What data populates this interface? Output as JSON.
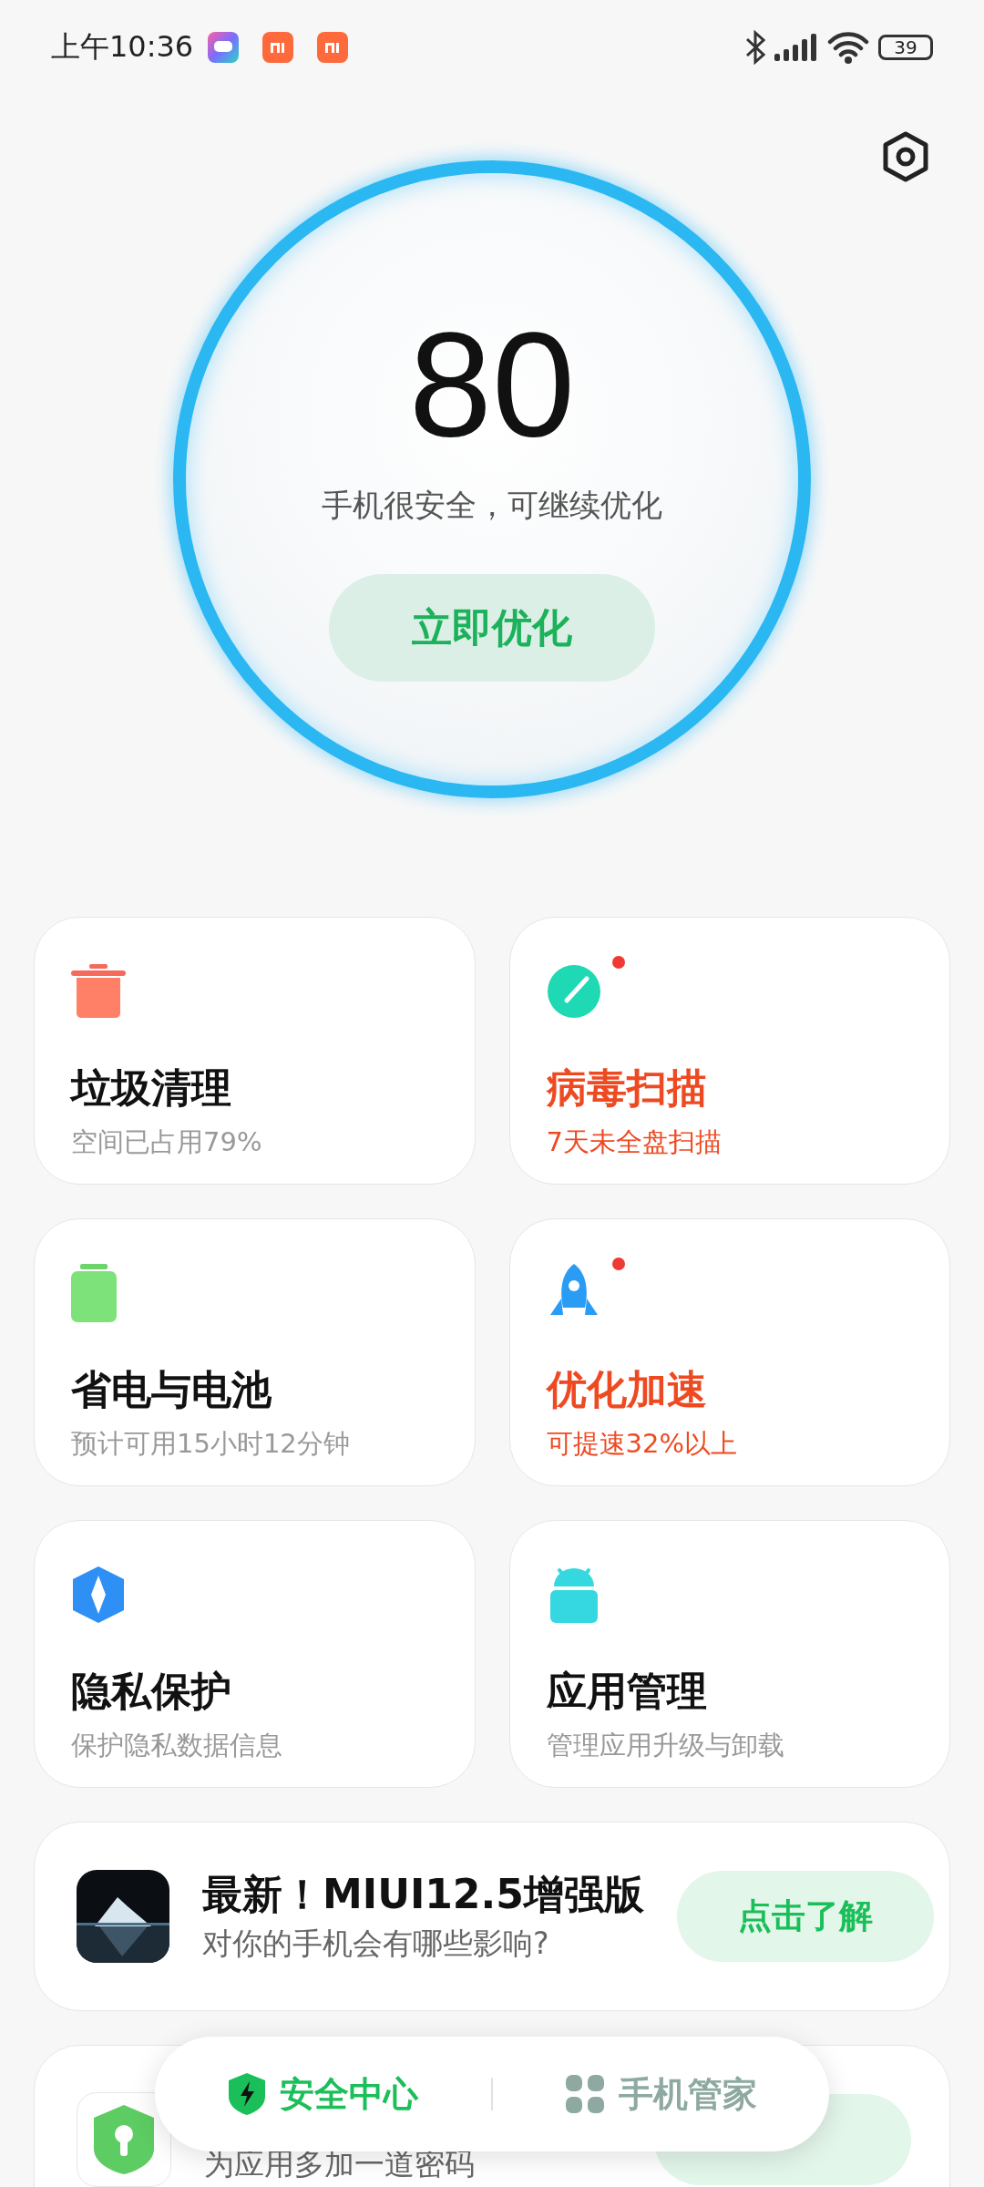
{
  "status_bar": {
    "time": "上午10:36",
    "battery": "39"
  },
  "score": {
    "value": "80",
    "message": "手机很安全，可继续优化",
    "button": "立即优化"
  },
  "tiles": [
    {
      "kind": "trash",
      "title": "垃圾清理",
      "subtitle": "空间已占用79%",
      "alert": false
    },
    {
      "kind": "scan",
      "title": "病毒扫描",
      "subtitle": "7天未全盘扫描",
      "alert": true
    },
    {
      "kind": "battery",
      "title": "省电与电池",
      "subtitle": "预计可用15小时12分钟",
      "alert": false
    },
    {
      "kind": "boost",
      "title": "优化加速",
      "subtitle": "可提速32%以上",
      "alert": true
    },
    {
      "kind": "privacy",
      "title": "隐私保护",
      "subtitle": "保护隐私数据信息",
      "alert": false
    },
    {
      "kind": "apps",
      "title": "应用管理",
      "subtitle": "管理应用升级与卸载",
      "alert": false
    }
  ],
  "promos": [
    {
      "kind": "picture",
      "title": "最新！MIUI12.5增强版",
      "subtitle": "对你的手机会有哪些影响?",
      "button": "点击了解"
    },
    {
      "kind": "lock",
      "subtitle": "为应用多加一道密码"
    }
  ],
  "bottom_nav": [
    {
      "label": "安全中心",
      "selected": true
    },
    {
      "label": "手机管家",
      "selected": false
    }
  ]
}
